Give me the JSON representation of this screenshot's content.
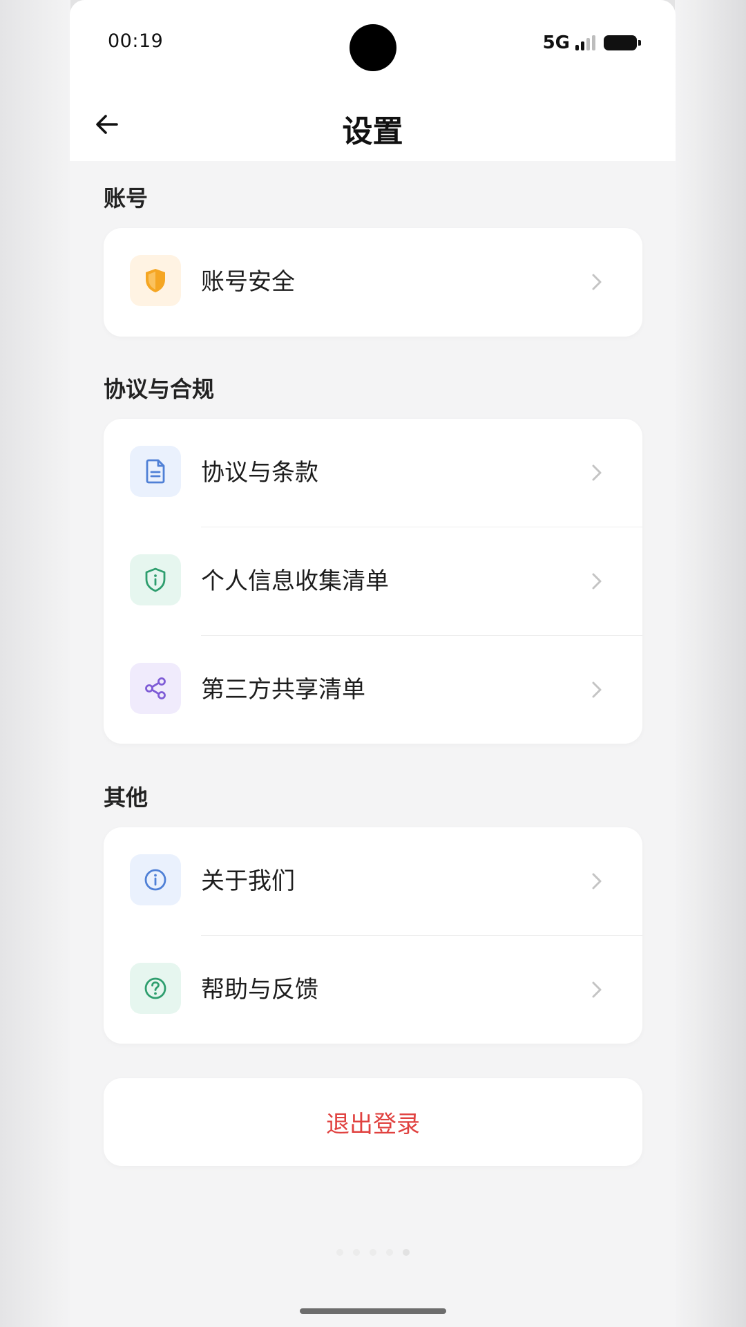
{
  "status_bar": {
    "time": "00:19",
    "network": "5G"
  },
  "header": {
    "title": "设置"
  },
  "sections": [
    {
      "title": "账号",
      "items": [
        {
          "label": "账号安全",
          "icon": "shield-icon",
          "icon_color": "#f5a623",
          "icon_bg": "#fff3e3"
        }
      ]
    },
    {
      "title": "协议与合规",
      "items": [
        {
          "label": "协议与条款",
          "icon": "document-icon",
          "icon_color": "#4f80d6",
          "icon_bg": "#eaf1fd"
        },
        {
          "label": "个人信息收集清单",
          "icon": "info-shield-icon",
          "icon_color": "#2e9e6e",
          "icon_bg": "#e6f6ef"
        },
        {
          "label": "第三方共享清单",
          "icon": "share-icon",
          "icon_color": "#7e5bd6",
          "icon_bg": "#f0ebfc"
        }
      ]
    },
    {
      "title": "其他",
      "items": [
        {
          "label": "关于我们",
          "icon": "info-icon",
          "icon_color": "#4f80d6",
          "icon_bg": "#eaf1fd"
        },
        {
          "label": "帮助与反馈",
          "icon": "help-icon",
          "icon_color": "#2e9e6e",
          "icon_bg": "#e6f6ef"
        }
      ]
    }
  ],
  "logout": {
    "label": "退出登录",
    "color": "#e0413f"
  }
}
